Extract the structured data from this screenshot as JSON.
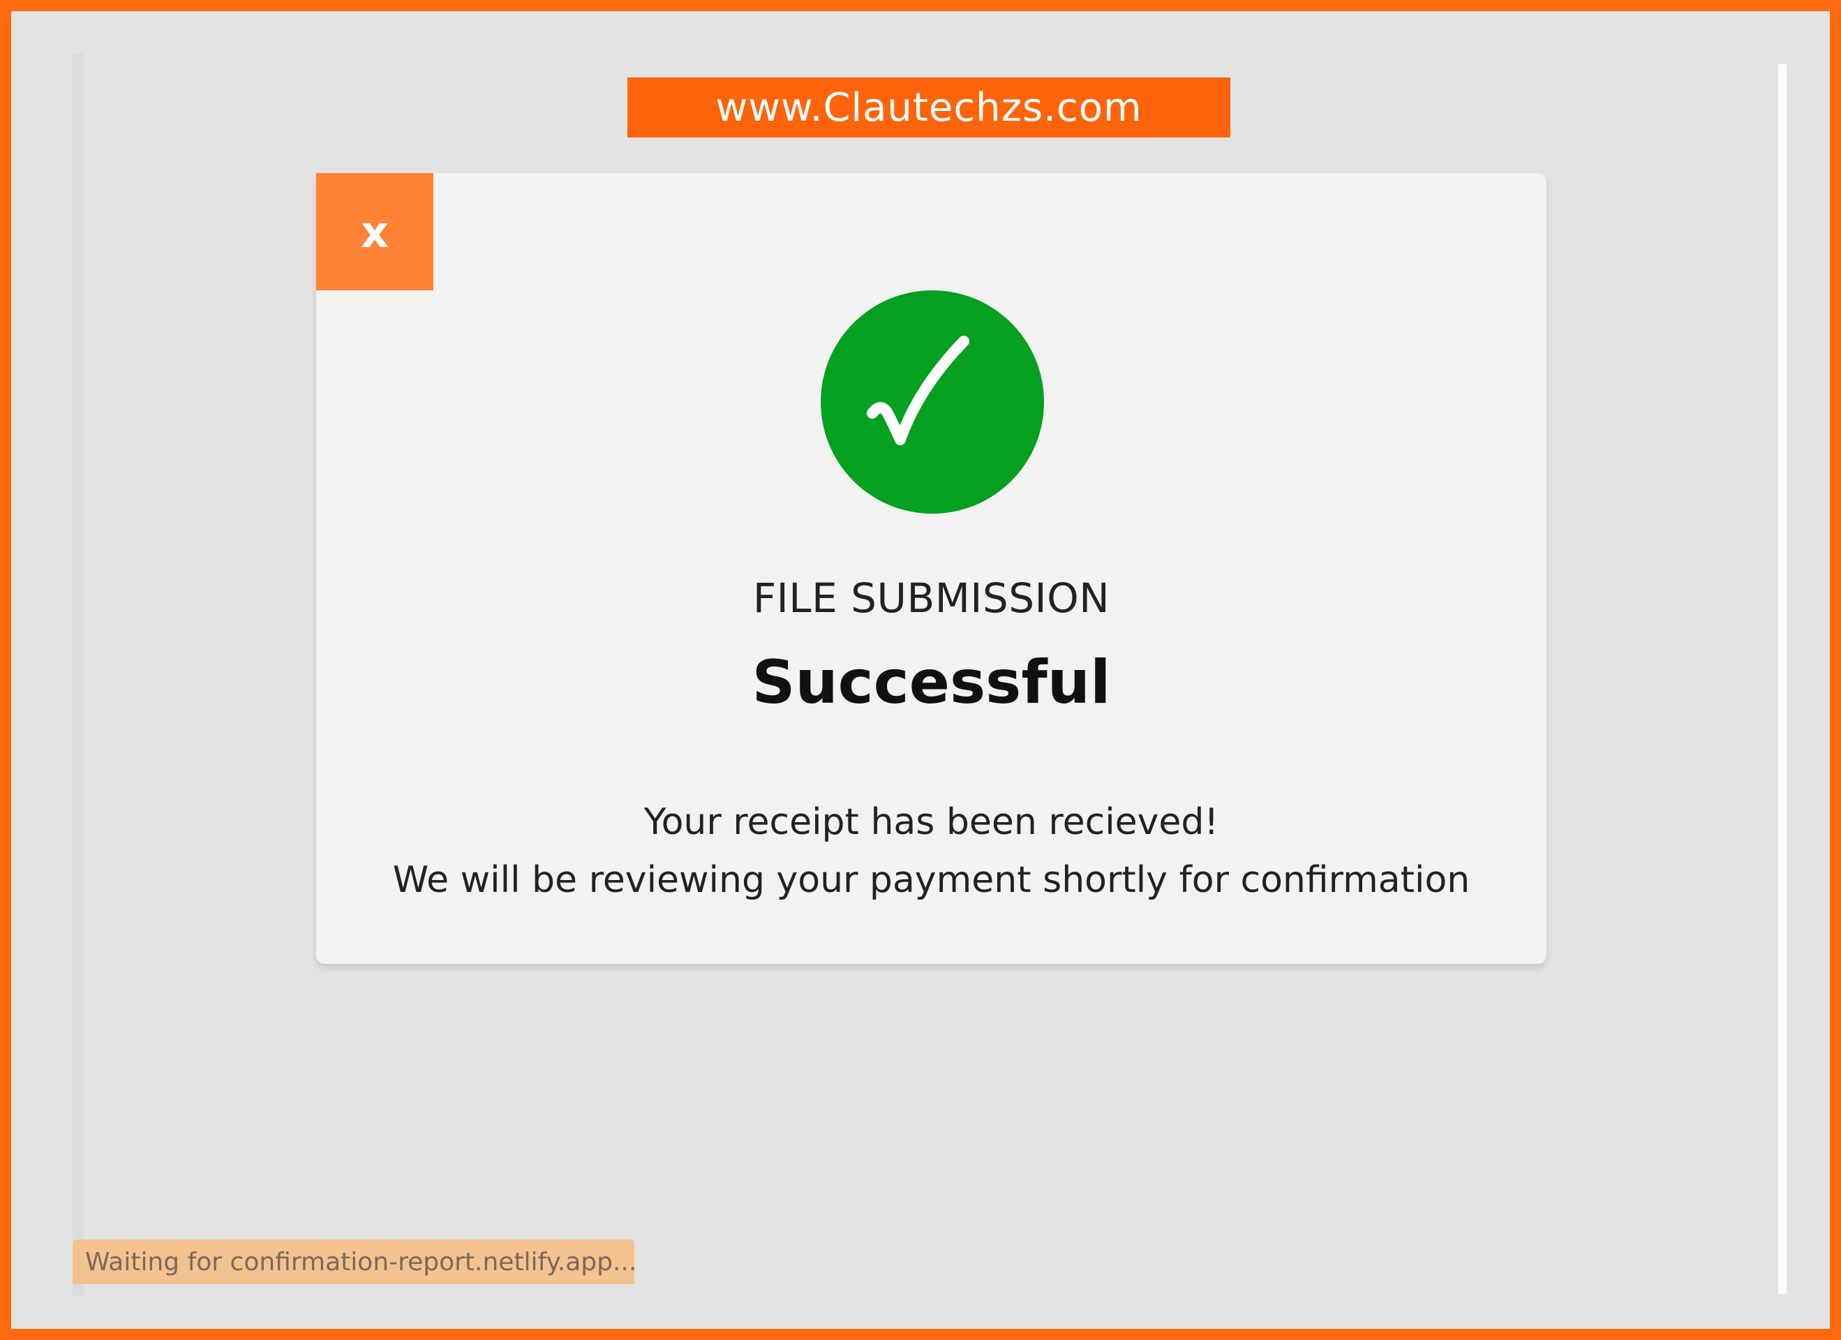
{
  "watermark": {
    "text": "www.Clautechzs.com"
  },
  "modal": {
    "close_label": "x",
    "heading": "FILE SUBMISSION",
    "title": "Successful",
    "message_line_1": "Your receipt has been recieved!",
    "message_line_2": "We will be reviewing your payment shortly for confirmation",
    "icon": "check-circle-icon"
  },
  "status_bar": {
    "text": "Waiting for confirmation-report.netlify.app..."
  },
  "colors": {
    "frame_border": "#ff6a0e",
    "close_button": "#ff8235",
    "success_green": "#04a01f",
    "modal_bg": "#f2f2f0",
    "page_bg": "#e3e3e3"
  }
}
